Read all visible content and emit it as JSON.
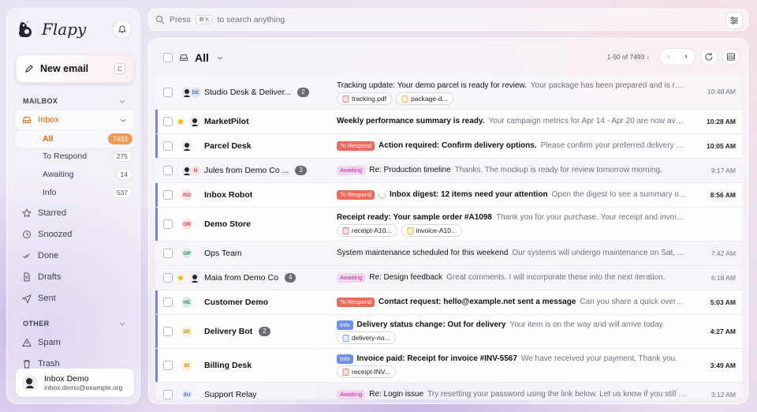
{
  "app": {
    "name": "Flapy"
  },
  "sidebar": {
    "new_email": "New email",
    "new_email_kbd": "C",
    "mailbox_label": "MAILBOX",
    "inbox": "Inbox",
    "subs": [
      {
        "label": "All",
        "count": "7493"
      },
      {
        "label": "To Respond",
        "count": "275"
      },
      {
        "label": "Awaiting",
        "count": "14"
      },
      {
        "label": "Info",
        "count": "537"
      }
    ],
    "items": [
      "Starred",
      "Snoozed",
      "Done",
      "Drafts",
      "Sent"
    ],
    "other_label": "OTHER",
    "other_items": [
      "Spam",
      "Trash"
    ],
    "user": {
      "name": "Inbox Demo",
      "email": "inbox.demo@example.org"
    }
  },
  "search": {
    "prefix": "Press",
    "kbd": "⌘ K",
    "suffix": "to search anything"
  },
  "toolbar": {
    "filter": "All",
    "pager": "1-50 of 7493 ↓"
  },
  "colors": {
    "accent": "#e8630a",
    "unread_bar": "#6f86e8",
    "to_respond": "#ec6a5c",
    "awaiting": "#b1339a",
    "info": "#6c8ef0"
  },
  "emails": [
    {
      "sender": "Studio Desk & Deliver...",
      "thread": "2",
      "subject": "Tracking update: Your demo parcel is ready for review.",
      "preview": "Your package has been prepared and is ready for revi...",
      "time": "10:48 AM",
      "attachments": [
        "tracking.pdf",
        "package-d..."
      ],
      "avatars": [
        "img",
        "DE"
      ]
    },
    {
      "sender": "MarketPilot",
      "subject": "Weekly performance summary is ready.",
      "preview": "Your campaign metrics for Apr 14 - Apr 20 are now available.",
      "time": "10:28 AM",
      "avatars": [
        "img"
      ]
    },
    {
      "sender": "Parcel Desk",
      "tag": "To Respond",
      "subject": "Action required: Confirm delivery options.",
      "preview": "Please confirm your preferred delivery window by Ap...",
      "time": "10:05 AM",
      "avatars": [
        "img"
      ]
    },
    {
      "sender": "Jules from Demo Co ...",
      "thread": "3",
      "tag": "Awaiting",
      "subject": "Re: Production timeline",
      "preview": "Thanks. The mockup is ready for review tomorrow morning.",
      "time": "9:17 AM",
      "avatars": [
        "img",
        "N"
      ]
    },
    {
      "sender": "Inbox Robot",
      "tag": "To Respond",
      "subject": "Inbox digest: 12 items need your attention",
      "preview": "Open the digest to see a summary of important up...",
      "time": "8:56 AM",
      "avatars": [
        "RO"
      ]
    },
    {
      "sender": "Demo Store",
      "subject": "Receipt ready: Your sample order #A1098",
      "preview": "Thank you for your purchase. Your receipt and invoice are attached.",
      "time": "8:31 AM",
      "attachments": [
        "receipt-A10...",
        "invoice-A10..."
      ],
      "avatars": [
        "OR"
      ]
    },
    {
      "sender": "Ops Team",
      "subject": "System maintenance scheduled for this weekend",
      "preview": "Our systems will undergo maintenance on Sat, Apr 26 from ...",
      "time": "7:42 AM",
      "avatars": [
        "OP"
      ]
    },
    {
      "sender": "Maia from Demo Co",
      "thread": "4",
      "tag": "Awaiting",
      "subject": "Re: Design feedback",
      "preview": "Great comments. I will incorporate these into the next iteration.",
      "time": "6:18 AM",
      "avatars": [
        "img"
      ]
    },
    {
      "sender": "Customer Demo",
      "tag": "To Respond",
      "subject": "Contact request: hello@example.net sent a message",
      "preview": "Can you share a quick overview of the Ente...",
      "time": "5:03 AM",
      "avatars": [
        "HE"
      ]
    },
    {
      "sender": "Delivery Bot",
      "thread": "2",
      "tag": "Info",
      "subject": "Delivery status change: Out for delivery",
      "preview": "Your item is on the way and will arrive today.",
      "time": "4:27 AM",
      "attachments": [
        "delivery-no..."
      ],
      "avatars": [
        "DE"
      ]
    },
    {
      "sender": "Billing Desk",
      "tag": "Info",
      "subject": "Invoice paid: Receipt for invoice #INV-5567",
      "preview": "We have received your payment. Thank you.",
      "time": "3:49 AM",
      "attachments": [
        "receipt-INV..."
      ],
      "avatars": [
        "BI"
      ]
    },
    {
      "sender": "Support Relay",
      "tag": "Awaiting",
      "subject": "Re: Login issue",
      "preview": "Try resetting your password using the link below. Let us know if you still need help.",
      "time": "3:12 AM",
      "avatars": [
        "SU"
      ]
    }
  ]
}
